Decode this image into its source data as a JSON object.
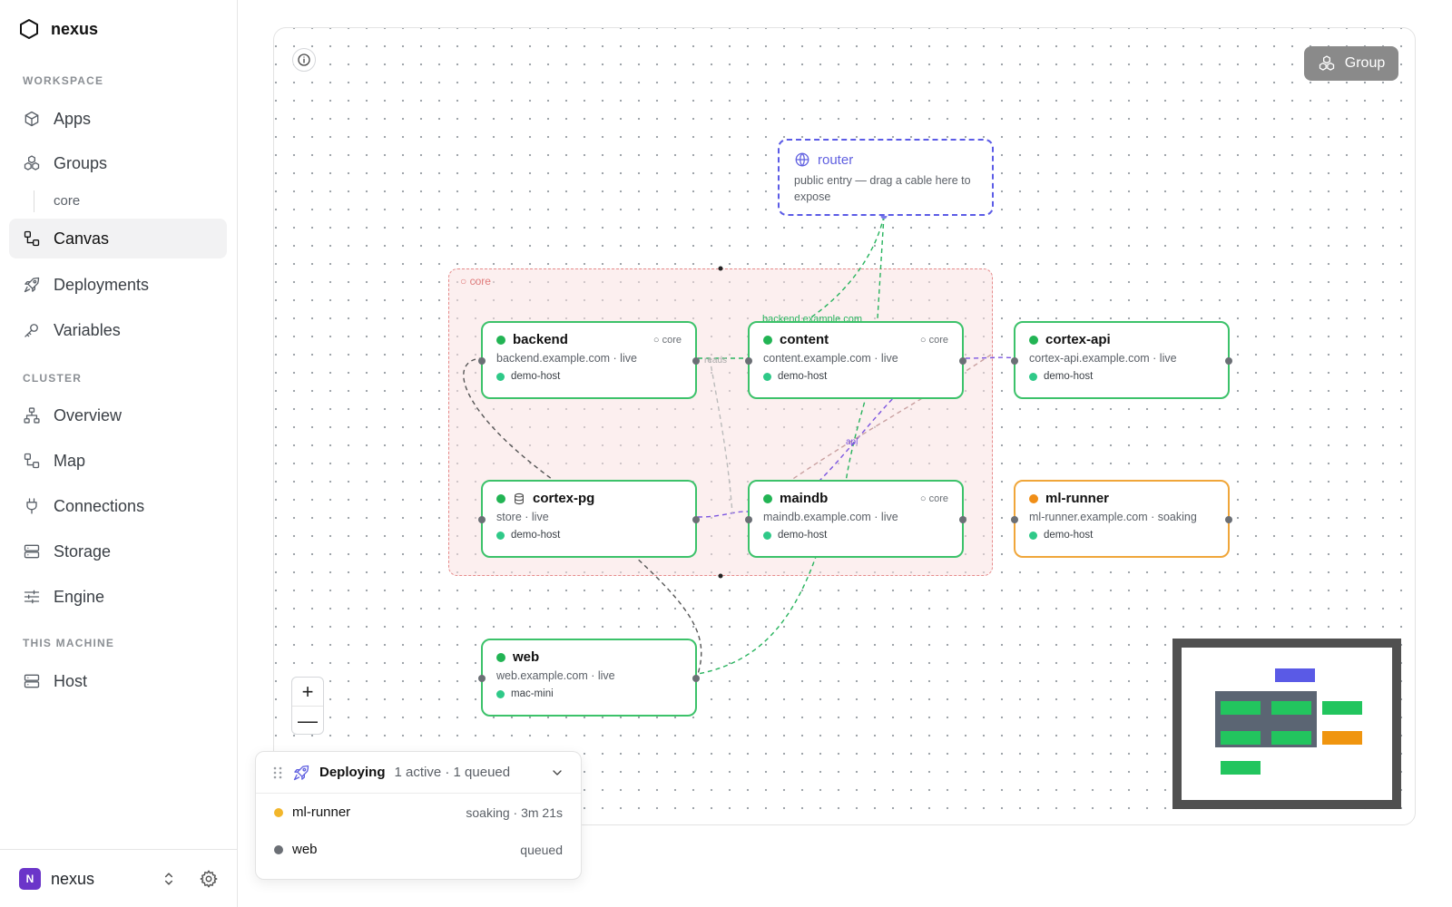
{
  "brand": {
    "name": "nexus"
  },
  "sidebar": {
    "workspace_label": "WORKSPACE",
    "cluster_label": "CLUSTER",
    "machine_label": "THIS MACHINE",
    "items": {
      "apps": "Apps",
      "groups": "Groups",
      "groups_sub": "core",
      "canvas": "Canvas",
      "deployments": "Deployments",
      "variables": "Variables",
      "overview": "Overview",
      "map": "Map",
      "connections": "Connections",
      "storage": "Storage",
      "engine": "Engine",
      "host": "Host"
    },
    "active": "canvas"
  },
  "footer": {
    "avatar": "N",
    "name": "nexus"
  },
  "canvas": {
    "group_button": "Group",
    "group": {
      "label": "core"
    },
    "router": {
      "title": "router",
      "description": "public entry — drag a cable here to expose"
    },
    "edge_labels": {
      "backend_domain": "backend.example.com",
      "reads": "reads",
      "api": "api"
    },
    "nodes": {
      "backend": {
        "name": "backend",
        "tag": "core",
        "url": "backend.example.com · live",
        "host": "demo-host",
        "status": "live"
      },
      "content": {
        "name": "content",
        "tag": "core",
        "url": "content.example.com · live",
        "host": "demo-host",
        "status": "live"
      },
      "cortex_api": {
        "name": "cortex-api",
        "tag": "",
        "url": "cortex-api.example.com · live",
        "host": "demo-host",
        "status": "live"
      },
      "cortex_pg": {
        "name": "cortex-pg",
        "tag": "",
        "url": "store · live",
        "host": "demo-host",
        "status": "live"
      },
      "maindb": {
        "name": "maindb",
        "tag": "core",
        "url": "maindb.example.com · live",
        "host": "demo-host",
        "status": "live"
      },
      "ml_runner": {
        "name": "ml-runner",
        "tag": "",
        "url": "ml-runner.example.com · soaking",
        "host": "demo-host",
        "status": "soaking"
      },
      "web": {
        "name": "web",
        "tag": "",
        "url": "web.example.com · live",
        "host": "mac-mini",
        "status": "live"
      }
    },
    "zoom": {
      "in": "+",
      "out": "—"
    }
  },
  "deploy_panel": {
    "title": "Deploying",
    "summary": "1 active · 1 queued",
    "rows": [
      {
        "name": "ml-runner",
        "status": "soaking · 3m 21s",
        "color": "#f2b62b"
      },
      {
        "name": "web",
        "status": "queued",
        "color": "#6b6f75"
      }
    ]
  },
  "colors": {
    "live": "#22b454",
    "soaking": "#f08e17",
    "router": "#5b5be6",
    "group": "#e68b8b"
  }
}
